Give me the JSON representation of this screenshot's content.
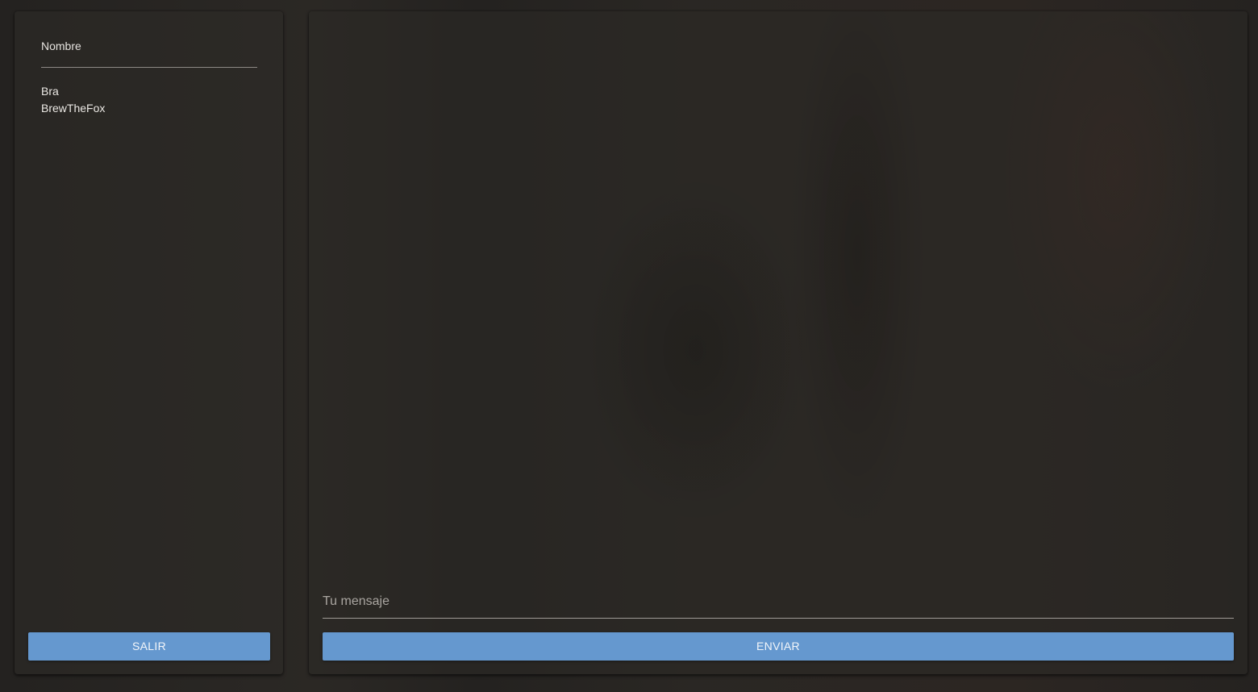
{
  "users_panel": {
    "header": "Nombre",
    "users": [
      "Bra",
      "BrewTheFox"
    ],
    "exit_label": "SALIR"
  },
  "chat_panel": {
    "message_placeholder": "Tu mensaje",
    "message_value": "",
    "send_label": "ENVIAR"
  },
  "colors": {
    "button": "#6598cf",
    "text": "#e6e3df",
    "panel": "#2e2b28"
  }
}
